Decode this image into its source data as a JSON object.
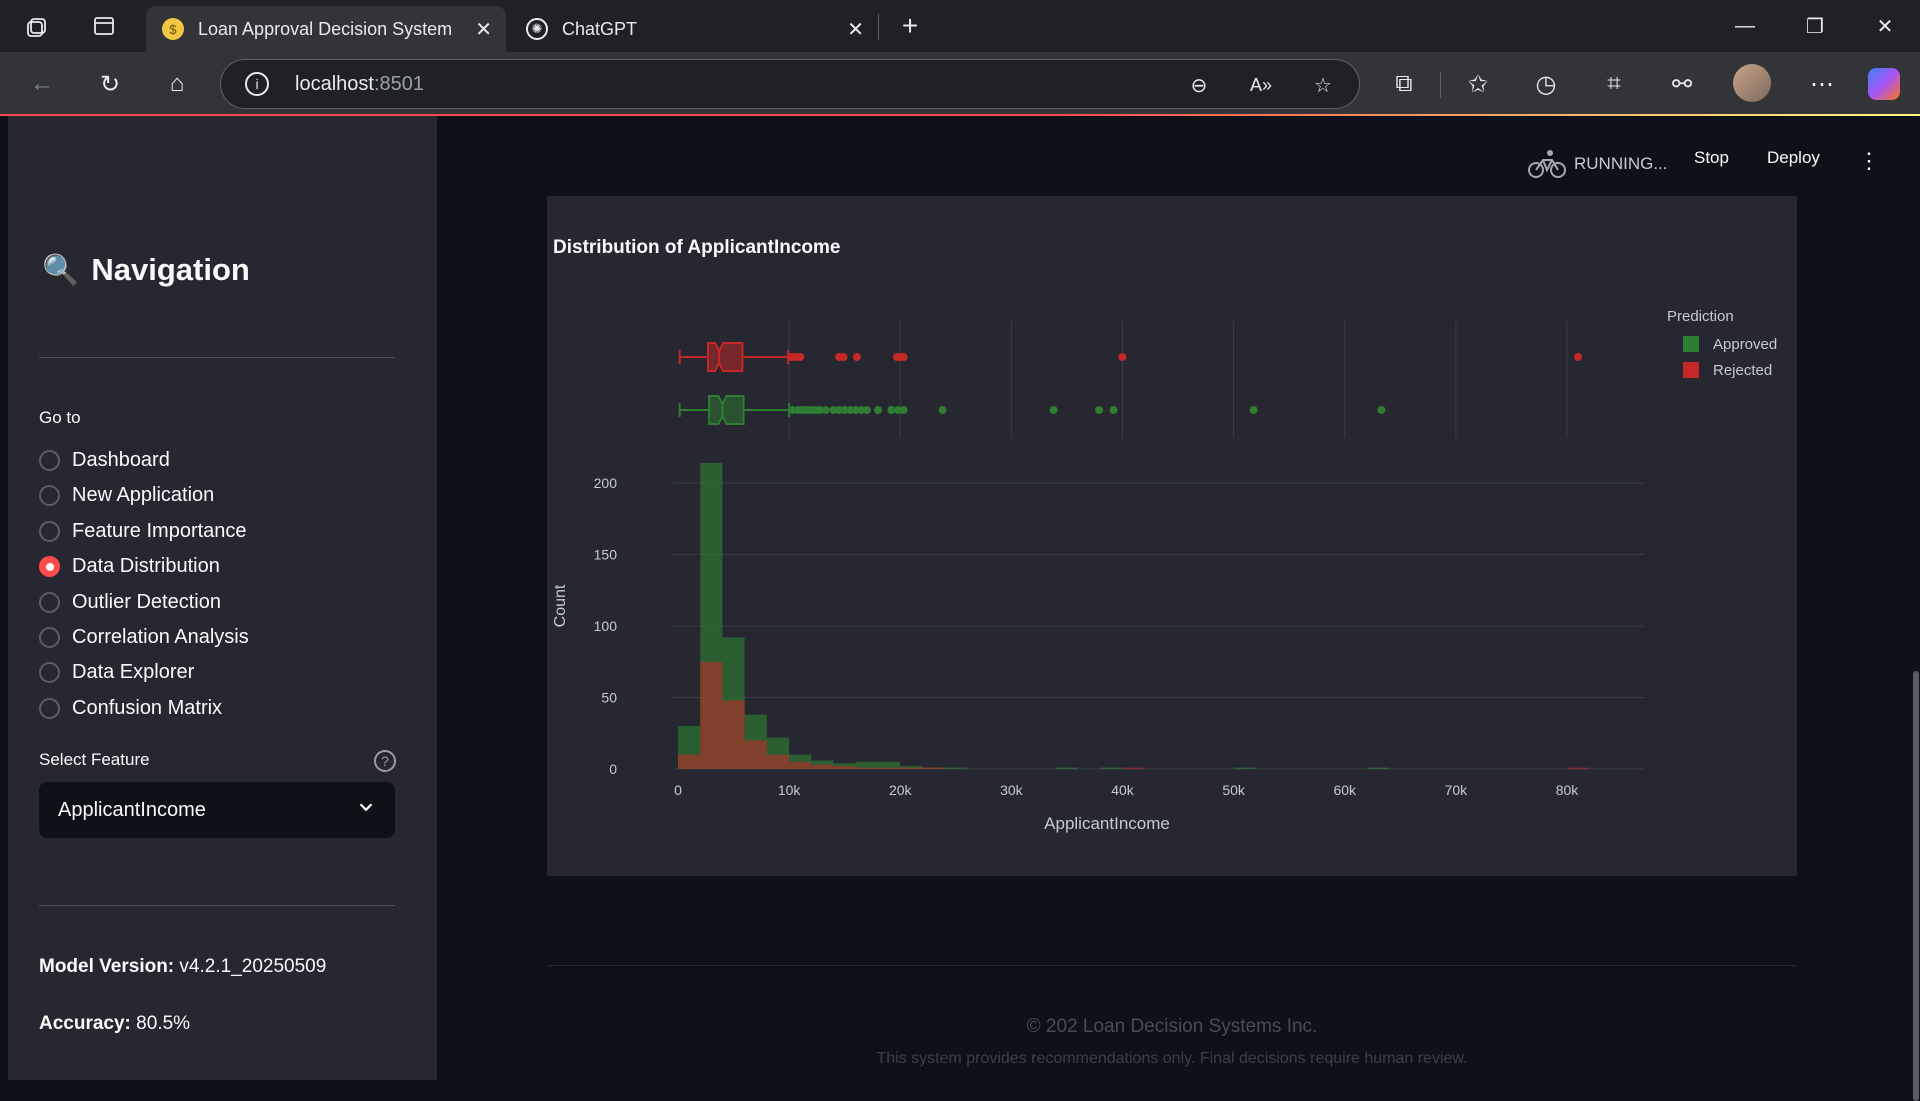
{
  "browser": {
    "tabs": [
      {
        "title": "Loan Approval Decision System",
        "favicon": "money-bag-icon"
      },
      {
        "title": "ChatGPT",
        "favicon": "chatgpt-icon"
      }
    ],
    "url_host": "localhost",
    "url_port": ":8501"
  },
  "app": {
    "status": "RUNNING...",
    "stop_label": "Stop",
    "deploy_label": "Deploy"
  },
  "sidebar": {
    "title": "Navigation",
    "title_icon": "magnifier-icon",
    "goto_label": "Go to",
    "items": [
      {
        "label": "Dashboard",
        "selected": false
      },
      {
        "label": "New Application",
        "selected": false
      },
      {
        "label": "Feature Importance",
        "selected": false
      },
      {
        "label": "Data Distribution",
        "selected": true
      },
      {
        "label": "Outlier Detection",
        "selected": false
      },
      {
        "label": "Correlation Analysis",
        "selected": false
      },
      {
        "label": "Data Explorer",
        "selected": false
      },
      {
        "label": "Confusion Matrix",
        "selected": false
      }
    ],
    "select_label": "Select Feature",
    "select_value": "ApplicantIncome",
    "model_version_label": "Model Version:",
    "model_version_value": "v4.2.1_20250509",
    "accuracy_label": "Accuracy:",
    "accuracy_value": "80.5%"
  },
  "chart_data": {
    "type": "bar",
    "title": "Distribution of ApplicantIncome",
    "xlabel": "ApplicantIncome",
    "ylabel": "Count",
    "xlim": [
      0,
      82000
    ],
    "ylim": [
      0,
      215
    ],
    "x_ticks": [
      "0",
      "10k",
      "20k",
      "30k",
      "40k",
      "50k",
      "60k",
      "70k",
      "80k"
    ],
    "y_ticks": [
      "0",
      "50",
      "100",
      "150",
      "200"
    ],
    "legend_title": "Prediction",
    "legend_position": "right",
    "bin_width": 2000,
    "bins_start": [
      0,
      2000,
      4000,
      6000,
      8000,
      10000,
      12000,
      14000,
      16000,
      18000,
      20000,
      22000,
      24000,
      34000,
      38000,
      40000,
      50000,
      62000,
      80000
    ],
    "series": [
      {
        "name": "Approved",
        "color": "#2e7d32",
        "values": [
          30,
          214,
          92,
          38,
          22,
          10,
          6,
          4,
          5,
          5,
          2,
          1,
          1,
          1,
          1,
          0,
          1,
          1,
          0
        ]
      },
      {
        "name": "Rejected",
        "color": "#c62828",
        "values": [
          10,
          75,
          48,
          20,
          10,
          5,
          3,
          2,
          1,
          1,
          1,
          1,
          0,
          0,
          0,
          1,
          0,
          0,
          1
        ]
      }
    ],
    "boxplots": [
      {
        "name": "Rejected",
        "min": 150,
        "q1": 2700,
        "median": 3700,
        "q3": 5800,
        "max": 9900,
        "outliers": [
          10200,
          10600,
          11000,
          14500,
          14900,
          16100,
          19700,
          20000,
          20300,
          40000,
          81000
        ]
      },
      {
        "name": "Approved",
        "min": 150,
        "q1": 2800,
        "median": 4000,
        "q3": 5900,
        "max": 10000,
        "outliers": [
          10300,
          10800,
          11200,
          11600,
          12000,
          12400,
          12800,
          13300,
          14000,
          14500,
          15000,
          15500,
          16000,
          16500,
          17000,
          18000,
          19200,
          19800,
          20300,
          23800,
          33800,
          37900,
          39200,
          51800,
          63300
        ]
      }
    ]
  },
  "footer": {
    "copyright": "© 202 Loan Decision Systems Inc.",
    "disclaimer": "This system provides recommendations only. Final decisions require human review."
  }
}
